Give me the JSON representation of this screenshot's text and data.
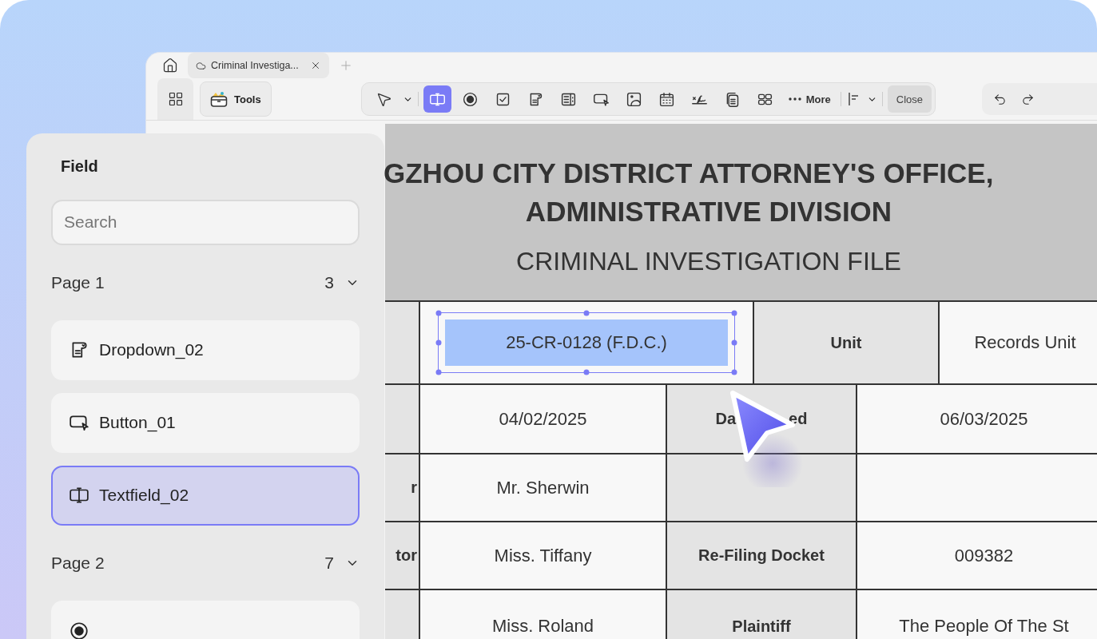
{
  "tabs": [
    {
      "label": "Criminal Investiga...",
      "selected": true
    }
  ],
  "tools_button": "Tools",
  "toolbar": {
    "tools": [
      {
        "kind": "select",
        "selected": false
      },
      {
        "kind": "textfield",
        "selected": true
      },
      {
        "kind": "radio",
        "selected": false
      },
      {
        "kind": "checkbox",
        "selected": false
      },
      {
        "kind": "dropdown",
        "selected": false
      },
      {
        "kind": "listbox",
        "selected": false
      },
      {
        "kind": "button",
        "selected": false
      },
      {
        "kind": "image",
        "selected": false
      },
      {
        "kind": "date",
        "selected": false
      },
      {
        "kind": "signature",
        "selected": false
      },
      {
        "kind": "copy",
        "selected": false
      },
      {
        "kind": "grid",
        "selected": false
      }
    ],
    "more": "More",
    "close": "Close"
  },
  "panel": {
    "title": "Field",
    "search_placeholder": "Search",
    "groups": [
      {
        "label": "Page 1",
        "count": "3",
        "items": [
          {
            "kind": "dropdown",
            "label": "Dropdown_02",
            "selected": false
          },
          {
            "kind": "button",
            "label": "Button_01",
            "selected": false
          },
          {
            "kind": "textfield",
            "label": "Textfield_02",
            "selected": true
          }
        ]
      },
      {
        "label": "Page 2",
        "count": "7",
        "items": [
          {
            "kind": "radio",
            "selected": false
          }
        ]
      }
    ]
  },
  "document": {
    "heading": [
      "GZHOU CITY DISTRICT ATTORNEY'S OFFICE,",
      "ADMINISTRATIVE DIVISION"
    ],
    "subtitle": "CRIMINAL INVESTIGATION FILE",
    "rows": [
      {
        "value": "25-CR-0128 (F.D.C.)",
        "value_selected": true,
        "label2": "Unit",
        "value2": "Records Unit"
      },
      {
        "value": "04/02/2025",
        "label2_parts": [
          "Da",
          "ed"
        ],
        "value2": "06/03/2025"
      },
      {
        "label": "r",
        "value": "Mr. Sherwin"
      },
      {
        "label": "tor",
        "value": "Miss. Tiffany",
        "label2": "Re-Filing Docket",
        "value2": "009382"
      },
      {
        "value": "Miss. Roland",
        "label2": "Plaintiff",
        "value2": "The People Of The St"
      }
    ]
  }
}
